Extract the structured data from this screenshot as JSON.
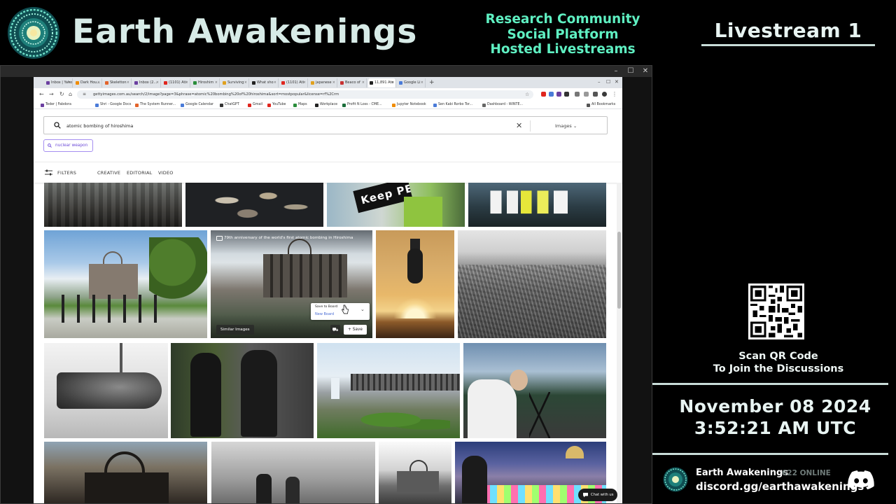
{
  "overlay": {
    "brand": "Earth Awakenings",
    "tagline": [
      "Research Community",
      "Social Platform",
      "Hosted Livestreams"
    ],
    "livestream_title": "Livestream 1",
    "qr_caption": [
      "Scan QR Code",
      "To Join the Discussions"
    ],
    "date": "November 08 2024",
    "time": "3:52:21 AM UTC",
    "discord": {
      "server_name": "Earth Awakenings",
      "online": "622 ONLINE",
      "invite": "discord.gg/earthawakenings"
    },
    "colors": {
      "accent": "#5ff0c2",
      "title": "#d7ebe7",
      "background": "#000000"
    }
  },
  "window_controls": {
    "minimize": "–",
    "maximize": "☐",
    "close": "✕"
  },
  "browser": {
    "tabs": [
      {
        "label": "Inbox | Yaho",
        "color": "#6b3fa0"
      },
      {
        "label": "Dark Hou...",
        "color": "#f08c00"
      },
      {
        "label": "Skeletton",
        "color": "#e3642b"
      },
      {
        "label": "Inbox (2...",
        "color": "#6b3fa0"
      },
      {
        "label": "(1101) Ati",
        "color": "#e0261f"
      },
      {
        "label": "Hiroshim",
        "color": "#2a8d3b"
      },
      {
        "label": "Surviving",
        "color": "#e0a11f"
      },
      {
        "label": "What sho",
        "color": "#222222"
      },
      {
        "label": "(1101) Ati",
        "color": "#e0261f"
      },
      {
        "label": "japanese",
        "color": "#e0a11f"
      },
      {
        "label": "Beaco of",
        "color": "#c83232"
      },
      {
        "label": "11,891 Ato",
        "color": "#222222"
      },
      {
        "label": "Google Li",
        "color": "#4a7bd8"
      }
    ],
    "url": "gettyimages.com.au/search/2/image?page=3&phrase=atomic%20bombing%20of%20hiroshima&sort=mostpopular&license=rf%2Crm",
    "bookmarks": [
      {
        "label": "Teder | Fabdora",
        "color": "#6b3fa0"
      },
      {
        "label": "Shri - Google Docs",
        "color": "#4a7bd8"
      },
      {
        "label": "The System Runner...",
        "color": "#e3642b"
      },
      {
        "label": "Google Calendar",
        "color": "#4a7bd8"
      },
      {
        "label": "ChatGPT",
        "color": "#333333"
      },
      {
        "label": "Gmail",
        "color": "#e0261f"
      },
      {
        "label": "YouTube",
        "color": "#e0261f"
      },
      {
        "label": "Maps",
        "color": "#2a8d3b"
      },
      {
        "label": "Workplace",
        "color": "#222222"
      },
      {
        "label": "Profit N Loss - CME...",
        "color": "#1b6e3b"
      },
      {
        "label": "Jupyter Notebook",
        "color": "#f08c00"
      },
      {
        "label": "Sen Kabi Rorbo Tor...",
        "color": "#4a7bd8"
      },
      {
        "label": "Dashboard - WINTE...",
        "color": "#666666"
      },
      {
        "label": "All Bookmarks",
        "color": "#555555"
      }
    ]
  },
  "page": {
    "search_query": "atomic bombing of hiroshima",
    "media_type": "Images",
    "suggestion_chip": "nuclear weapon",
    "filters_label": "FILTERS",
    "filter_tabs": [
      "CREATIVE",
      "EDITORIAL",
      "VIDEO"
    ],
    "hover_tile": {
      "caption": "79th anniversary of the world's first atomic bombing in Hiroshima",
      "save_to_board": "Save to Board",
      "new_board": "New Board",
      "similar_images": "Similar Images",
      "save": "+ Save"
    },
    "sign_text": "Keep PEACE",
    "chat_button": "Chat with us"
  }
}
